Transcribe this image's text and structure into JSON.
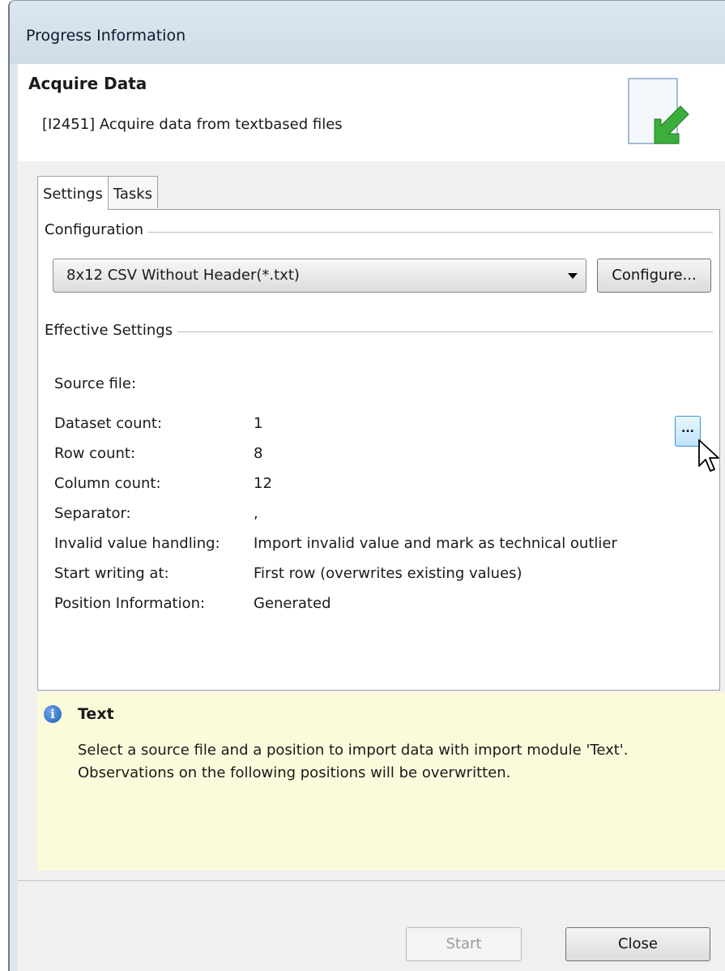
{
  "window": {
    "title": "Progress Information"
  },
  "header": {
    "title": "Acquire Data",
    "subtitle": "[I2451] Acquire data from textbased files",
    "icon": "import-document-icon"
  },
  "tabs": [
    {
      "label": "Settings",
      "active": true
    },
    {
      "label": "Tasks",
      "active": false
    }
  ],
  "configuration": {
    "group_title": "Configuration",
    "selected": "8x12 CSV Without Header(*.txt)",
    "configure_label": "Configure..."
  },
  "effective_settings": {
    "group_title": "Effective Settings",
    "source_file_label": "Source file:",
    "browse_label": "...",
    "rows": [
      {
        "label": "Dataset count:",
        "value": "1"
      },
      {
        "label": "Row count:",
        "value": "8"
      },
      {
        "label": "Column count:",
        "value": "12"
      },
      {
        "label": "Separator:",
        "value": ","
      },
      {
        "label": "Invalid value handling:",
        "value": "Import invalid value and mark as technical outlier"
      },
      {
        "label": "Start writing at:",
        "value": "First row (overwrites existing values)"
      },
      {
        "label": "Position Information:",
        "value": "Generated"
      }
    ]
  },
  "info": {
    "icon": "info-icon",
    "title": "Text",
    "text": "Select a source file and a position to import data with import module 'Text'. Observations on the following positions will be overwritten."
  },
  "footer": {
    "start_label": "Start",
    "start_enabled": false,
    "close_label": "Close"
  },
  "colors": {
    "info_background": "#fbfbdc",
    "accent": "#1b5fb8",
    "arrow_green": "#3cae3c"
  }
}
